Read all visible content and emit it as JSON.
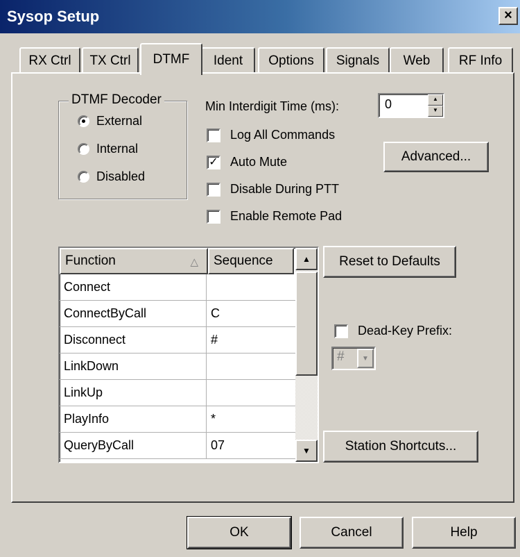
{
  "window": {
    "title": "Sysop Setup",
    "close_glyph": "×"
  },
  "tabs": [
    {
      "label": "RX Ctrl",
      "active": false
    },
    {
      "label": "TX Ctrl",
      "active": false
    },
    {
      "label": "DTMF",
      "active": true
    },
    {
      "label": "Ident",
      "active": false
    },
    {
      "label": "Options",
      "active": false
    },
    {
      "label": "Signals",
      "active": false
    },
    {
      "label": "Web",
      "active": false
    },
    {
      "label": "RF Info",
      "active": false
    }
  ],
  "decoder": {
    "title": "DTMF Decoder",
    "options": [
      {
        "label": "External",
        "selected": true
      },
      {
        "label": "Internal",
        "selected": false
      },
      {
        "label": "Disabled",
        "selected": false
      }
    ]
  },
  "interdigit": {
    "label": "Min Interdigit Time (ms):",
    "value": "0"
  },
  "checkboxes": [
    {
      "label": "Log All Commands",
      "checked": false
    },
    {
      "label": "Auto Mute",
      "checked": true
    },
    {
      "label": "Disable During PTT",
      "checked": false
    },
    {
      "label": "Enable Remote Pad",
      "checked": false
    }
  ],
  "buttons": {
    "advanced": "Advanced...",
    "reset": "Reset to Defaults",
    "station_shortcuts": "Station Shortcuts...",
    "ok": "OK",
    "cancel": "Cancel",
    "help": "Help"
  },
  "table": {
    "columns": [
      "Function",
      "Sequence"
    ],
    "sort_column": "Function",
    "rows": [
      {
        "function": "Connect",
        "sequence": ""
      },
      {
        "function": "ConnectByCall",
        "sequence": "C"
      },
      {
        "function": "Disconnect",
        "sequence": "#"
      },
      {
        "function": "LinkDown",
        "sequence": ""
      },
      {
        "function": "LinkUp",
        "sequence": ""
      },
      {
        "function": "PlayInfo",
        "sequence": "*"
      },
      {
        "function": "QueryByCall",
        "sequence": "07"
      }
    ]
  },
  "dead_key": {
    "label": "Dead-Key Prefix:",
    "checked": false,
    "value": "#",
    "enabled": false
  },
  "colors": {
    "titlebar_start": "#0a246a",
    "titlebar_end": "#a6caf0",
    "face": "#d4d0c8"
  }
}
